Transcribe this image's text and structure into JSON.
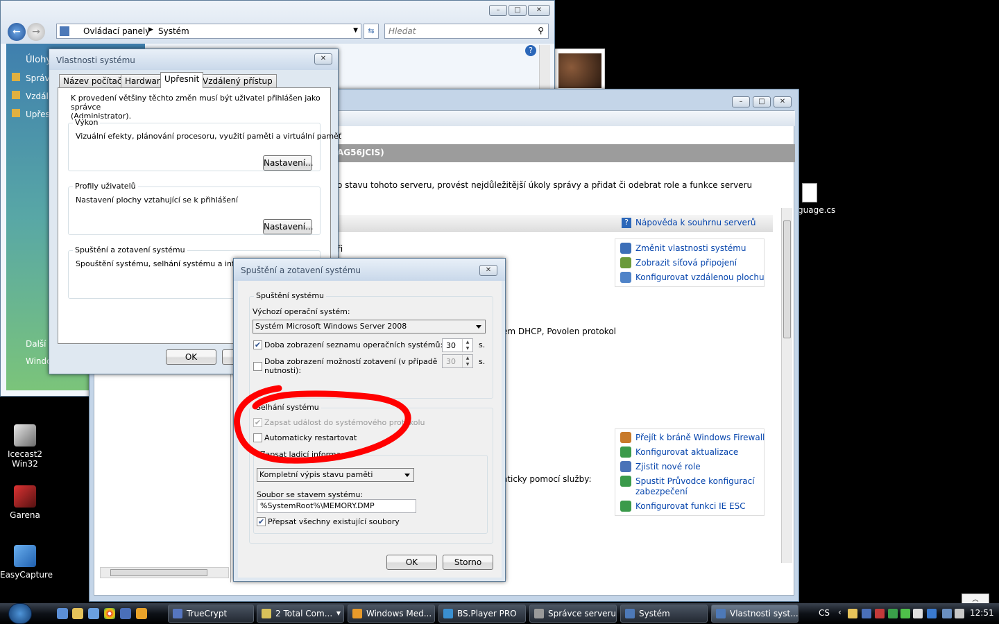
{
  "desktop": {
    "icons": [
      {
        "label1": "Icecast2",
        "label2": "Win32"
      },
      {
        "label1": "Garena",
        "label2": ""
      },
      {
        "label1": "EasyCapture",
        "label2": ""
      }
    ],
    "file_label": "guage.cs"
  },
  "explorer": {
    "path": [
      "Ovládací panely",
      "Systém"
    ],
    "search_placeholder": "Hledat",
    "sidebar": {
      "title": "Úlohy",
      "items": [
        "Správc",
        "Vzdále",
        "Upřesn"
      ],
      "bottom": [
        "Další",
        "Windo"
      ]
    }
  },
  "server_manager": {
    "header_fragment": "AG56JCIS)",
    "desc_fragment": "o stavu tohoto serveru, provést nejdůležitější úkoly správy a přidat či odebrat role a funkce serveru",
    "help_link": "Nápověda k souhrnu serverů",
    "frag1": "ři",
    "frag2": "em DHCP, Povolen protokol",
    "frag3": "aticky pomocí služby:",
    "links_top": [
      "Změnit vlastnosti systému",
      "Zobrazit síťová připojení",
      "Konfigurovat vzdálenou plochu"
    ],
    "links_bottom": [
      "Přejít k bráně Windows Firewall",
      "Konfigurovat aktualizace",
      "Zjistit nové role",
      "Spustit Průvodce konfigurací",
      "zabezpečení",
      "Konfigurovat funkci IE ESC"
    ]
  },
  "sysprops": {
    "title": "Vlastnosti systému",
    "tabs": [
      "Název počítače",
      "Hardware",
      "Upřesnit",
      "Vzdálený přístup"
    ],
    "intro": [
      "K provedení většiny těchto změn musí být uživatel přihlášen jako správce",
      "(Administrator)."
    ],
    "perf": {
      "title": "Výkon",
      "text": "Vizuální efekty, plánování procesoru, využití paměti a virtuální paměť",
      "button": "Nastavení..."
    },
    "profiles": {
      "title": "Profily uživatelů",
      "text": "Nastavení plochy vztahující se k přihlášení",
      "button": "Nastavení..."
    },
    "startup": {
      "title": "Spuštění a zotavení systému",
      "text": "Spouštění systému, selhání systému a informace o ladění"
    },
    "ok": "OK"
  },
  "startup_dialog": {
    "title": "Spuštění a zotavení systému",
    "group1": "Spuštění systému",
    "default_os_label": "Výchozí operační systém:",
    "default_os_value": "Systém Microsoft Windows Server 2008",
    "show_list_label": "Doba zobrazení seznamu operačních systémů:",
    "show_list_value": "30",
    "show_recovery_label1": "Doba zobrazení možností zotavení (v případě",
    "show_recovery_label2": "nutnosti):",
    "show_recovery_value": "30",
    "seconds": "s.",
    "group2": "Selhání systému",
    "write_event": "Zapsat událost do systémového protokolu",
    "auto_restart": "Automaticky restartovat",
    "debug_group": "Zapsat ladicí informace",
    "debug_value": "Kompletní výpis stavu paměti",
    "dump_label": "Soubor se stavem systému:",
    "dump_value": "%SystemRoot%\\MEMORY.DMP",
    "overwrite": "Přepsat všechny existující soubory",
    "ok": "OK",
    "cancel": "Storno"
  },
  "taskbar": {
    "tasks": [
      "TrueCrypt",
      "2 Total Com...",
      "Windows Med...",
      "BS.Player PRO",
      "Správce serveru",
      "Systém",
      "Vlastnosti syst..."
    ],
    "lang": "CS",
    "clock": "12:51"
  },
  "colors": {
    "annotation": "#ff0000",
    "link": "#0645ad",
    "header_bar": "#9c9c9c"
  }
}
